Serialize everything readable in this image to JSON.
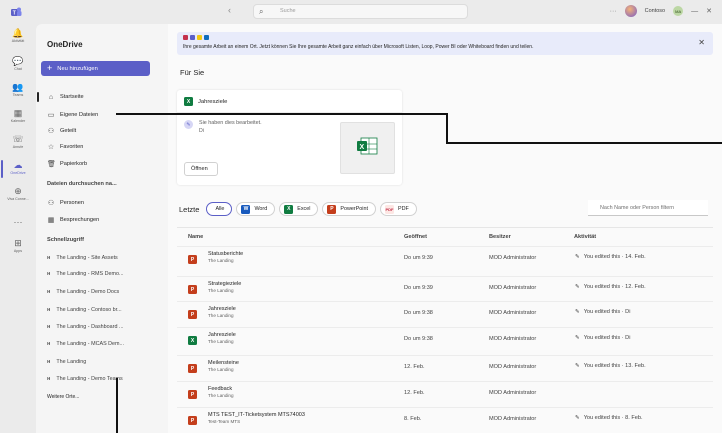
{
  "titlebar": {
    "search_placeholder": "Suche",
    "nav_arrows": "‹ ›",
    "org_name": "Contoso",
    "org_badge": "MA",
    "more": "···",
    "minimize": "—",
    "close": "✕"
  },
  "rail": [
    {
      "label": "Aktivität",
      "icon": "bell-icon",
      "glyph": "🔔"
    },
    {
      "label": "Chat",
      "icon": "chat-icon",
      "glyph": "💬"
    },
    {
      "label": "Teams",
      "icon": "teams-icon",
      "glyph": "👥"
    },
    {
      "label": "Kalender",
      "icon": "calendar-icon",
      "glyph": "▦"
    },
    {
      "label": "Anrufe",
      "icon": "phone-icon",
      "glyph": "☏"
    },
    {
      "label": "OneDrive",
      "icon": "cloud-icon",
      "glyph": "☁"
    },
    {
      "label": "Viva Conne...",
      "icon": "viva-icon",
      "glyph": "⊕"
    },
    {
      "label": "",
      "icon": "more-icon",
      "glyph": "···"
    },
    {
      "label": "Apps",
      "icon": "apps-icon",
      "glyph": "⊞"
    }
  ],
  "nav": {
    "title": "OneDrive",
    "new_button": "Neu hinzufügen",
    "items": [
      {
        "label": "Startseite",
        "icon": "home-icon",
        "glyph": "⌂"
      },
      {
        "label": "Eigene Dateien",
        "icon": "folder-icon",
        "glyph": "▭"
      },
      {
        "label": "Geteilt",
        "icon": "people-icon",
        "glyph": "⚇"
      },
      {
        "label": "Favoriten",
        "icon": "star-icon",
        "glyph": "☆"
      },
      {
        "label": "Papierkorb",
        "icon": "trash-icon",
        "glyph": "🗑"
      }
    ],
    "browse_heading": "Dateien durchsuchen na...",
    "browse_items": [
      {
        "label": "Personen",
        "icon": "person-icon",
        "glyph": "⚇"
      },
      {
        "label": "Besprechungen",
        "icon": "calendar-icon",
        "glyph": "▦"
      }
    ],
    "quick_heading": "Schnellzugriff",
    "quick_items": [
      "The Landing - Site Assets",
      "The Landing - RMS Demo...",
      "The Landing - Demo Docs",
      "The Landing - Contoso br...",
      "The Landing - Dashboard ...",
      "The Landing - MCAS Dem...",
      "The Landing",
      "The Landing - Demo Teams"
    ],
    "more_places": "Weitere Orte..."
  },
  "banner": {
    "text": "Ihre gesamte Arbeit an einem Ort. Jetzt können Sie Ihre gesamte Arbeit ganz einfach über Microsoft Listen, Loop, Power BI oder Whiteboard finden und teilen.",
    "close": "✕",
    "app_colors": [
      "#c4314b",
      "#5b5fc7",
      "#f2c811",
      "#0f6cbd"
    ]
  },
  "for_you": {
    "title": "Für Sie",
    "card": {
      "file_name": "Jahresziele",
      "edit_text": "Sie haben dies bearbeitet.",
      "edit_when": "Di",
      "open_button": "Öffnen"
    }
  },
  "recent": {
    "label": "Letzte",
    "filters": [
      {
        "label": "Alle",
        "type": "all"
      },
      {
        "label": "Word",
        "type": "word"
      },
      {
        "label": "Excel",
        "type": "excel"
      },
      {
        "label": "PowerPoint",
        "type": "powerpoint"
      },
      {
        "label": "PDF",
        "type": "pdf"
      }
    ],
    "search_placeholder": "Nach Name oder Person filtern",
    "columns": [
      "Name",
      "Geöffnet",
      "Besitzer",
      "Aktivität"
    ],
    "rows": [
      {
        "name": "Statusberichte",
        "location": "The Landing",
        "type": "pp",
        "opened": "Do um 9:39",
        "owner": "MOD Administrator",
        "activity": "You edited this · 14. Feb."
      },
      {
        "name": "Strategieziele",
        "location": "The Landing",
        "type": "pp",
        "opened": "Do um 9:39",
        "owner": "MOD Administrator",
        "activity": "You edited this · 12. Feb."
      },
      {
        "name": "Jahresziele",
        "location": "The Landing",
        "type": "pp",
        "opened": "Do um 9:38",
        "owner": "MOD Administrator",
        "activity": "You edited this · Di"
      },
      {
        "name": "Jahresziele",
        "location": "The Landing",
        "type": "xl",
        "opened": "Do um 9:38",
        "owner": "MOD Administrator",
        "activity": "You edited this · Di"
      },
      {
        "name": "Meilensteine",
        "location": "The Landing",
        "type": "pp",
        "opened": "12. Feb.",
        "owner": "MOD Administrator",
        "activity": "You edited this · 13. Feb."
      },
      {
        "name": "Feedback",
        "location": "The Landing",
        "type": "pp",
        "opened": "12. Feb.",
        "owner": "MOD Administrator",
        "activity": ""
      },
      {
        "name": "MTS TEST_IT-Ticketsystem MTS74003",
        "location": "Test-Team MTS",
        "type": "pp",
        "opened": "8. Feb.",
        "owner": "MOD Administrator",
        "activity": "You edited this · 8. Feb."
      }
    ]
  }
}
